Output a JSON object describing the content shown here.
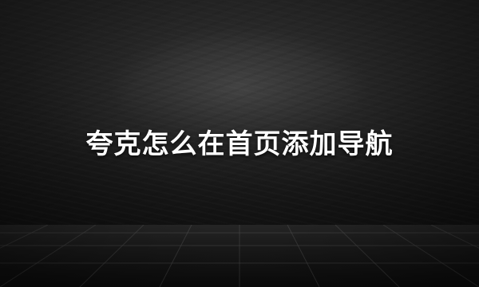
{
  "headline": "夸克怎么在首页添加导航"
}
